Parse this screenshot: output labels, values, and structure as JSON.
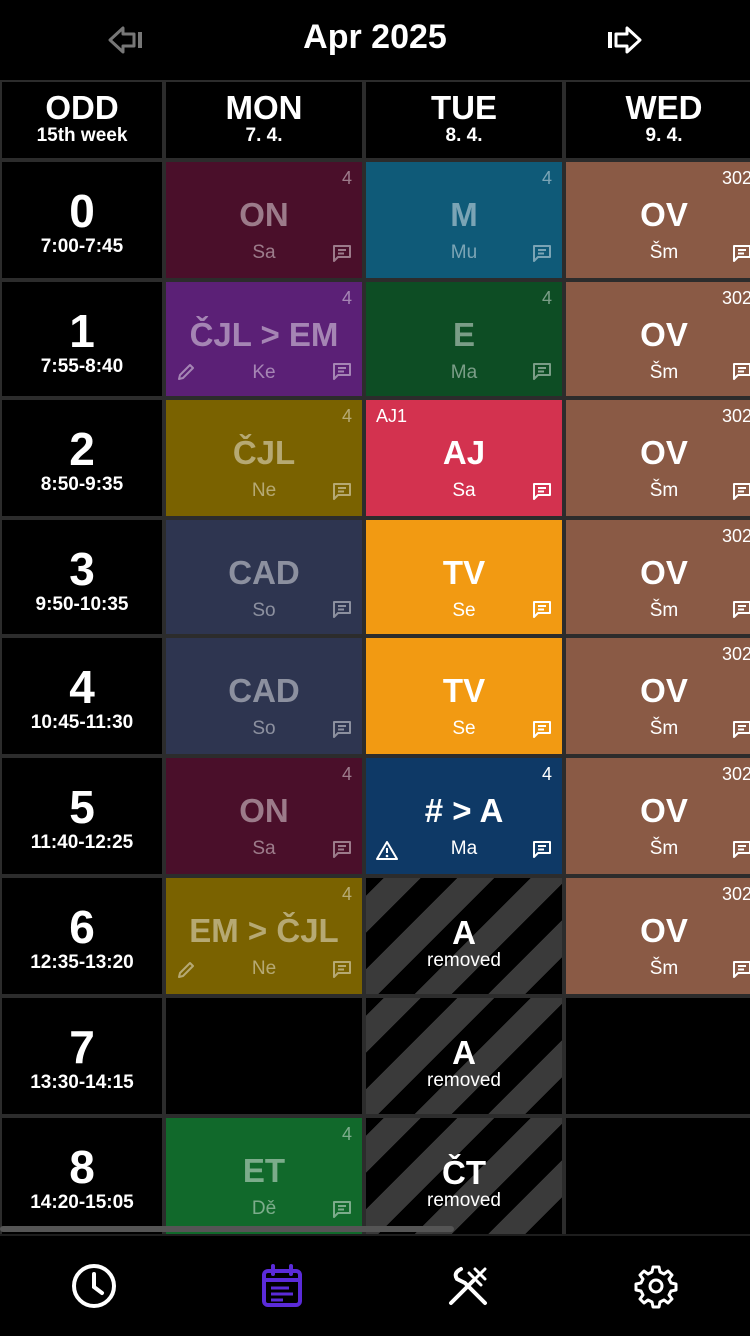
{
  "header": {
    "month_title": "Apr 2025"
  },
  "week": {
    "parity": "ODD",
    "label": "15th week"
  },
  "days": [
    {
      "name": "MON",
      "date": "7. 4."
    },
    {
      "name": "TUE",
      "date": "8. 4."
    },
    {
      "name": "WED",
      "date": "9. 4."
    }
  ],
  "periods": [
    {
      "num": "0",
      "time": "7:00-7:45"
    },
    {
      "num": "1",
      "time": "7:55-8:40"
    },
    {
      "num": "2",
      "time": "8:50-9:35"
    },
    {
      "num": "3",
      "time": "9:50-10:35"
    },
    {
      "num": "4",
      "time": "10:45-11:30"
    },
    {
      "num": "5",
      "time": "11:40-12:25"
    },
    {
      "num": "6",
      "time": "12:35-13:20"
    },
    {
      "num": "7",
      "time": "13:30-14:15"
    },
    {
      "num": "8",
      "time": "14:20-15:05"
    }
  ],
  "lessons": {
    "mon": [
      {
        "subject": "ON",
        "teacher": "Sa",
        "room": "4",
        "color": "#4a0f2a",
        "dim": true,
        "note": true
      },
      {
        "subject": "ČJL > EM",
        "teacher": "Ke",
        "room": "4",
        "color": "#5b2076",
        "dim": true,
        "note": true,
        "edit": true
      },
      {
        "subject": "ČJL",
        "teacher": "Ne",
        "room": "4",
        "color": "#7a6200",
        "dim": true,
        "note": true
      },
      {
        "subject": "CAD",
        "teacher": "So",
        "room": "",
        "color": "#2e3550",
        "dim": true,
        "note": true
      },
      {
        "subject": "CAD",
        "teacher": "So",
        "room": "",
        "color": "#2e3550",
        "dim": true,
        "note": true
      },
      {
        "subject": "ON",
        "teacher": "Sa",
        "room": "4",
        "color": "#4a0f2a",
        "dim": true,
        "note": true
      },
      {
        "subject": "EM > ČJL",
        "teacher": "Ne",
        "room": "4",
        "color": "#7a6200",
        "dim": true,
        "note": true,
        "edit": true
      },
      null,
      {
        "subject": "ET",
        "teacher": "Dě",
        "room": "4",
        "color": "#11692b",
        "dim": true,
        "note": true
      }
    ],
    "tue": [
      {
        "subject": "M",
        "teacher": "Mu",
        "room": "4",
        "color": "#0f5a78",
        "dim": true,
        "note": true
      },
      {
        "subject": "E",
        "teacher": "Ma",
        "room": "4",
        "color": "#0d4d24",
        "dim": true,
        "note": true
      },
      {
        "subject": "AJ",
        "teacher": "Sa",
        "group": "AJ1",
        "color": "#d3324f",
        "dim": false,
        "note": true
      },
      {
        "subject": "TV",
        "teacher": "Se",
        "color": "#f29a12",
        "dim": false,
        "note": true
      },
      {
        "subject": "TV",
        "teacher": "Se",
        "color": "#f29a12",
        "dim": false,
        "note": true
      },
      {
        "subject": "# > A",
        "teacher": "Ma",
        "room": "4",
        "color": "#0e3966",
        "dim": false,
        "note": true,
        "warn": true
      },
      {
        "subject": "A",
        "removed_label": "removed",
        "removed": true
      },
      {
        "subject": "A",
        "removed_label": "removed",
        "removed": true
      },
      {
        "subject": "ČT",
        "removed_label": "removed",
        "removed": true
      }
    ],
    "wed": [
      {
        "subject": "OV",
        "teacher": "Šm",
        "room": "302",
        "color": "#8a5a45",
        "dim": false,
        "note": true
      },
      {
        "subject": "OV",
        "teacher": "Šm",
        "room": "302",
        "color": "#8a5a45",
        "dim": false,
        "note": true
      },
      {
        "subject": "OV",
        "teacher": "Šm",
        "room": "302",
        "color": "#8a5a45",
        "dim": false,
        "note": true
      },
      {
        "subject": "OV",
        "teacher": "Šm",
        "room": "302",
        "color": "#8a5a45",
        "dim": false,
        "note": true
      },
      {
        "subject": "OV",
        "teacher": "Šm",
        "room": "302",
        "color": "#8a5a45",
        "dim": false,
        "note": true
      },
      {
        "subject": "OV",
        "teacher": "Šm",
        "room": "302",
        "color": "#8a5a45",
        "dim": false,
        "note": true
      },
      {
        "subject": "OV",
        "teacher": "Šm",
        "room": "302",
        "color": "#8a5a45",
        "dim": false,
        "note": true
      },
      null,
      null
    ]
  },
  "bottom_nav": [
    {
      "icon": "clock-icon",
      "active": false
    },
    {
      "icon": "calendar-icon",
      "active": true,
      "color": "#5b2bd9"
    },
    {
      "icon": "fork-knife-icon",
      "active": false
    },
    {
      "icon": "gear-icon",
      "active": false
    }
  ]
}
